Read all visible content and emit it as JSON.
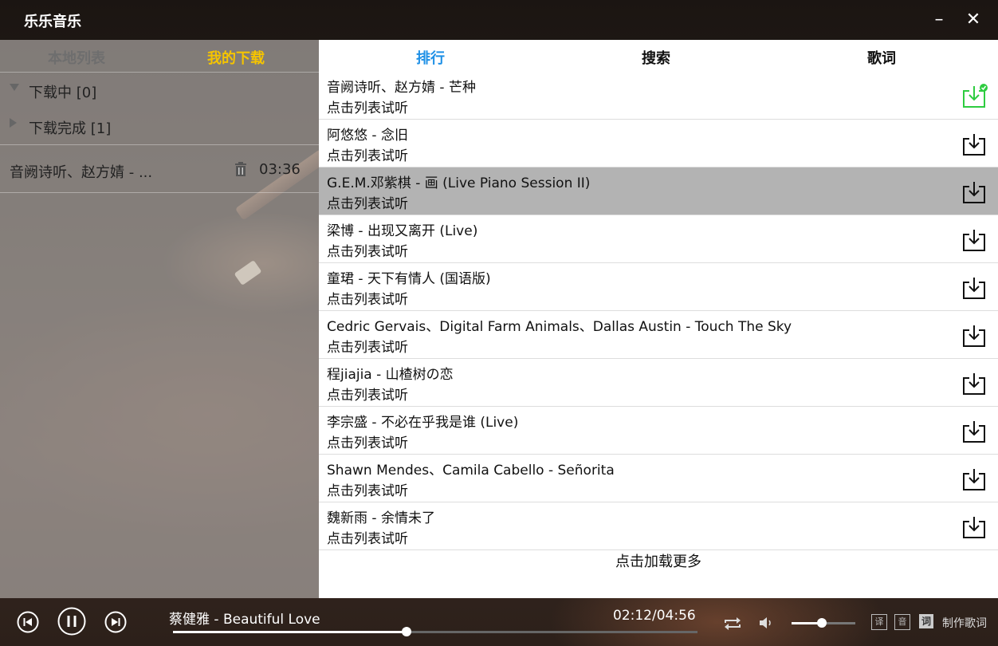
{
  "app": {
    "title": "乐乐音乐"
  },
  "window": {
    "minimize": "–",
    "close": "✕"
  },
  "left_panel": {
    "tabs": [
      {
        "label": "本地列表",
        "active": false
      },
      {
        "label": "我的下载",
        "active": true
      }
    ],
    "groups": [
      {
        "label": "下载中 [0]",
        "expanded": true
      },
      {
        "label": "下载完成 [1]",
        "expanded": false
      }
    ],
    "downloaded": [
      {
        "name": "音阙诗听、赵方婧 - ...",
        "duration": "03:36"
      }
    ]
  },
  "right_panel": {
    "tabs": [
      {
        "label": "排行",
        "active": true
      },
      {
        "label": "搜索",
        "active": false
      },
      {
        "label": "歌词",
        "active": false
      }
    ],
    "songs": [
      {
        "title": "音阙诗听、赵方婧 - 芒种",
        "hint": "点击列表试听",
        "downloaded": true
      },
      {
        "title": "阿悠悠 - 念旧",
        "hint": "点击列表试听",
        "downloaded": false
      },
      {
        "title": "G.E.M.邓紫棋 - 画 (Live Piano Session II)",
        "hint": "点击列表试听",
        "downloaded": false,
        "selected": true
      },
      {
        "title": "梁博 - 出现又离开 (Live)",
        "hint": "点击列表试听",
        "downloaded": false
      },
      {
        "title": "童珺 - 天下有情人 (国语版)",
        "hint": "点击列表试听",
        "downloaded": false
      },
      {
        "title": "Cedric Gervais、Digital Farm Animals、Dallas Austin - Touch The Sky",
        "hint": "点击列表试听",
        "downloaded": false
      },
      {
        "title": "程jiajia - 山楂树の恋",
        "hint": "点击列表试听",
        "downloaded": false
      },
      {
        "title": "李宗盛 - 不必在乎我是谁 (Live)",
        "hint": "点击列表试听",
        "downloaded": false
      },
      {
        "title": "Shawn Mendes、Camila Cabello - Señorita",
        "hint": "点击列表试听",
        "downloaded": false
      },
      {
        "title": "魏新雨 - 余情未了",
        "hint": "点击列表试听",
        "downloaded": false
      }
    ],
    "load_more": "点击加载更多"
  },
  "player": {
    "now_playing": "蔡健雅 - Beautiful Love",
    "time": "02:12/04:56",
    "progress": 0.446,
    "volume": 0.47,
    "translate_label": "译",
    "transliterate_label": "音",
    "lyrics_label": "词",
    "make_lyrics": "制作歌词"
  },
  "colors": {
    "accent_tab": "#1e90e6",
    "active_left_tab": "#f5c400",
    "download_done": "#2ecc40"
  }
}
